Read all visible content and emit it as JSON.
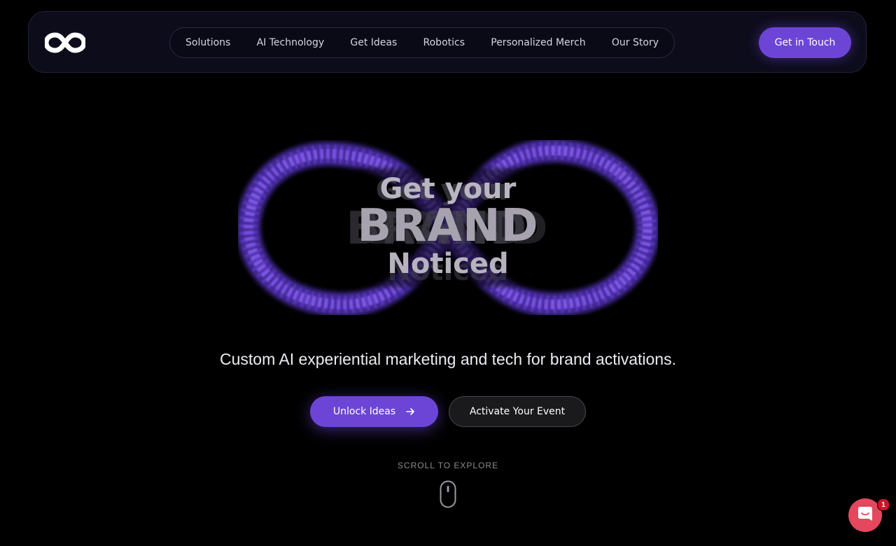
{
  "brand": {
    "logo_icon": "infinity-logo-icon"
  },
  "nav": {
    "items": [
      {
        "label": "Solutions"
      },
      {
        "label": "AI Technology"
      },
      {
        "label": "Get Ideas"
      },
      {
        "label": "Robotics"
      },
      {
        "label": "Personalized Merch"
      },
      {
        "label": "Our Story"
      }
    ],
    "cta_label": "Get in Touch"
  },
  "hero": {
    "headline_line1": "Get your",
    "headline_line2": "BRAND",
    "headline_line3": "Noticed",
    "art_icon": "particle-infinity-icon",
    "tagline": "Custom AI experiential marketing and tech for brand activations.",
    "primary_button": "Unlock Ideas",
    "primary_button_icon": "arrow-right-icon",
    "secondary_button": "Activate Your Event",
    "scroll_label": "SCROLL TO EXPLORE",
    "scroll_icon": "mouse-icon"
  },
  "chat": {
    "icon": "chat-icon",
    "badge_count": "1"
  },
  "colors": {
    "accent": "#6d45d6",
    "background": "#000000",
    "navbar_bg": "#0d0c1b",
    "chat_red": "#e5475e"
  }
}
